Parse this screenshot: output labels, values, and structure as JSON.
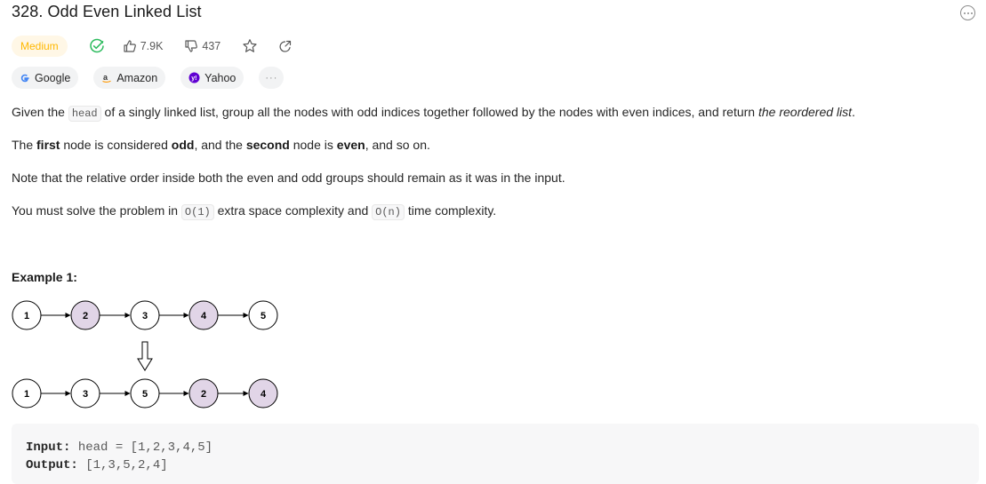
{
  "problem": {
    "title": "328. Odd Even Linked List",
    "difficulty": "Medium",
    "likes": "7.9K",
    "dislikes": "437"
  },
  "companies": [
    {
      "name": "Google"
    },
    {
      "name": "Amazon"
    },
    {
      "name": "Yahoo"
    }
  ],
  "more_tags": "···",
  "description": {
    "p1_pre": "Given the ",
    "p1_code": "head",
    "p1_mid": " of a singly linked list, group all the nodes with odd indices together followed by the nodes with even indices, and return ",
    "p1_em": "the reordered list",
    "p1_end": ".",
    "p2_a": "The ",
    "p2_b": "first",
    "p2_c": " node is considered ",
    "p2_d": "odd",
    "p2_e": ", and the ",
    "p2_f": "second",
    "p2_g": " node is ",
    "p2_h": "even",
    "p2_i": ", and so on.",
    "p3": "Note that the relative order inside both the even and odd groups should remain as it was in the input.",
    "p4_a": "You must solve the problem in ",
    "p4_code1": "O(1)",
    "p4_b": " extra space complexity and ",
    "p4_code2": "O(n)",
    "p4_c": " time complexity."
  },
  "example": {
    "title": "Example 1:",
    "input_label": "Input:",
    "input_value": " head = [1,2,3,4,5]",
    "output_label": "Output:",
    "output_value": " [1,3,5,2,4]",
    "before_nodes": [
      "1",
      "2",
      "3",
      "4",
      "5"
    ],
    "after_nodes": [
      "1",
      "3",
      "5",
      "2",
      "4"
    ],
    "odd_fill": "#ffffff",
    "even_fill": "#e1d5e7"
  },
  "colors": {
    "medium": "#ffb800",
    "solved": "#2cbb5d"
  }
}
